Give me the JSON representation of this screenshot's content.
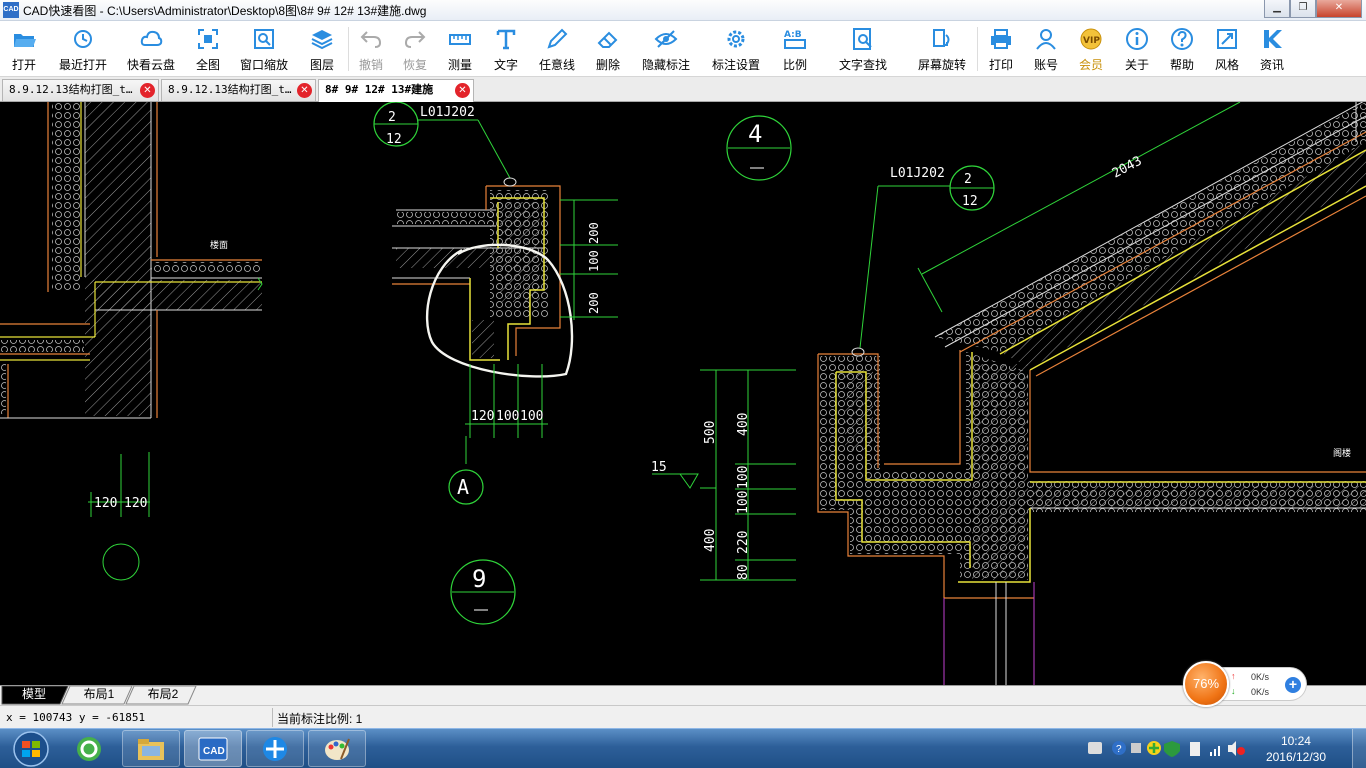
{
  "window": {
    "title": "CAD快速看图 - C:\\Users\\Administrator\\Desktop\\8图\\8# 9# 12# 13#建施.dwg",
    "app_icon_text": "CAD"
  },
  "toolbar": {
    "items": [
      {
        "label": "打开",
        "icon": "folder-open-icon",
        "enabled": true
      },
      {
        "label": "最近打开",
        "icon": "clock-history-icon",
        "enabled": true
      },
      {
        "label": "快看云盘",
        "icon": "cloud-icon",
        "enabled": true
      },
      {
        "label": "全图",
        "icon": "fit-all-icon",
        "enabled": true
      },
      {
        "label": "窗口缩放",
        "icon": "zoom-window-icon",
        "enabled": true
      },
      {
        "label": "图层",
        "icon": "layers-icon",
        "enabled": true
      },
      {
        "label": "撤销",
        "icon": "undo-icon",
        "enabled": false
      },
      {
        "label": "恢复",
        "icon": "redo-icon",
        "enabled": false
      },
      {
        "label": "测量",
        "icon": "ruler-icon",
        "enabled": true
      },
      {
        "label": "文字",
        "icon": "text-t-icon",
        "enabled": true
      },
      {
        "label": "任意线",
        "icon": "pen-icon",
        "enabled": true
      },
      {
        "label": "删除",
        "icon": "eraser-icon",
        "enabled": true
      },
      {
        "label": "隐藏标注",
        "icon": "eye-hide-icon",
        "enabled": true
      },
      {
        "label": "标注设置",
        "icon": "gear-icon",
        "enabled": true
      },
      {
        "label": "比例",
        "icon": "ratio-icon",
        "enabled": true
      },
      {
        "label": "文字查找",
        "icon": "text-search-icon",
        "enabled": true
      },
      {
        "label": "屏幕旋转",
        "icon": "rotate-screen-icon",
        "enabled": true
      },
      {
        "label": "打印",
        "icon": "printer-icon",
        "enabled": true
      },
      {
        "label": "账号",
        "icon": "user-icon",
        "enabled": true
      },
      {
        "label": "会员",
        "icon": "vip-icon",
        "enabled": true
      },
      {
        "label": "关于",
        "icon": "info-icon",
        "enabled": true
      },
      {
        "label": "帮助",
        "icon": "help-icon",
        "enabled": true
      },
      {
        "label": "风格",
        "icon": "style-icon",
        "enabled": true
      },
      {
        "label": "资讯",
        "icon": "news-k-icon",
        "enabled": true
      }
    ]
  },
  "tabs": [
    {
      "label": "8.9.12.13结构打图_t…",
      "active": false
    },
    {
      "label": "8.9.12.13结构打图_t…",
      "active": false
    },
    {
      "label": "8# 9# 12# 13#建施",
      "active": true
    }
  ],
  "drawing": {
    "labels": {
      "ref_left_num": "2",
      "ref_left_den": "12",
      "ref_left_code": "L01J202",
      "ref_right_num": "2",
      "ref_right_den": "12",
      "ref_right_code": "L01J202",
      "section_4": "4",
      "section_9": "9",
      "axis_a": "A",
      "dim_2043": "2043",
      "dim_200a": "200",
      "dim_100": "100",
      "dim_200b": "200",
      "dim_120a": "120",
      "dim_100a": "100",
      "dim_100b": "100",
      "dim_120l1": "120",
      "dim_120l2": "120",
      "dim_500": "500",
      "dim_400a": "400",
      "dim_100c": "100",
      "dim_100d": "100",
      "dim_220": "220",
      "dim_80": "80",
      "dim_400b": "400",
      "elev_15": "15",
      "note_floor": "楼面",
      "note_loft": "阁楼"
    }
  },
  "layout_tabs": [
    "模型",
    "布局1",
    "布局2"
  ],
  "status": {
    "coords": "x = 100743  y = -61851",
    "scale": "当前标注比例: 1"
  },
  "net_widget": {
    "percent": "76%",
    "up": "0K/s",
    "down": "0K/s"
  },
  "taskbar": {
    "time": "10:24",
    "date": "2016/12/30",
    "apps": [
      "ie-icon",
      "explorer-icon",
      "cad-icon",
      "move-app-icon",
      "paint-icon"
    ]
  }
}
